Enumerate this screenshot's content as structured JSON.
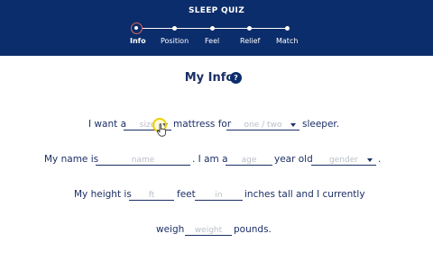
{
  "header": {
    "title": "SLEEP QUIZ",
    "steps": [
      {
        "label": "Info",
        "active": true
      },
      {
        "label": "Position",
        "active": false
      },
      {
        "label": "Feel",
        "active": false
      },
      {
        "label": "Relief",
        "active": false
      },
      {
        "label": "Match",
        "active": false
      }
    ]
  },
  "section": {
    "title": "My Info",
    "help_icon": "?"
  },
  "form": {
    "row1": {
      "text_before": "I want a",
      "size_placeholder": "size",
      "text_mid": "mattress for",
      "count_placeholder": "one / two",
      "text_after": "sleeper."
    },
    "row2": {
      "text_before": "My name is",
      "name_placeholder": "name",
      "text_mid": ". I am a",
      "age_placeholder": "age",
      "text_mid2": "year old",
      "gender_placeholder": "gender",
      "text_after": "."
    },
    "row3": {
      "text_before": "My height is",
      "ft_placeholder": "ft",
      "text_mid": "feet",
      "in_placeholder": "in",
      "text_after": "inches tall and I currently"
    },
    "row4": {
      "text_before": "weigh",
      "weight_placeholder": "weight",
      "text_after": "pounds."
    }
  },
  "colors": {
    "header_bg": "#0b2d6b",
    "text": "#1c2f66",
    "placeholder": "#b9bec9",
    "active_step_ring": "#e0605a"
  }
}
